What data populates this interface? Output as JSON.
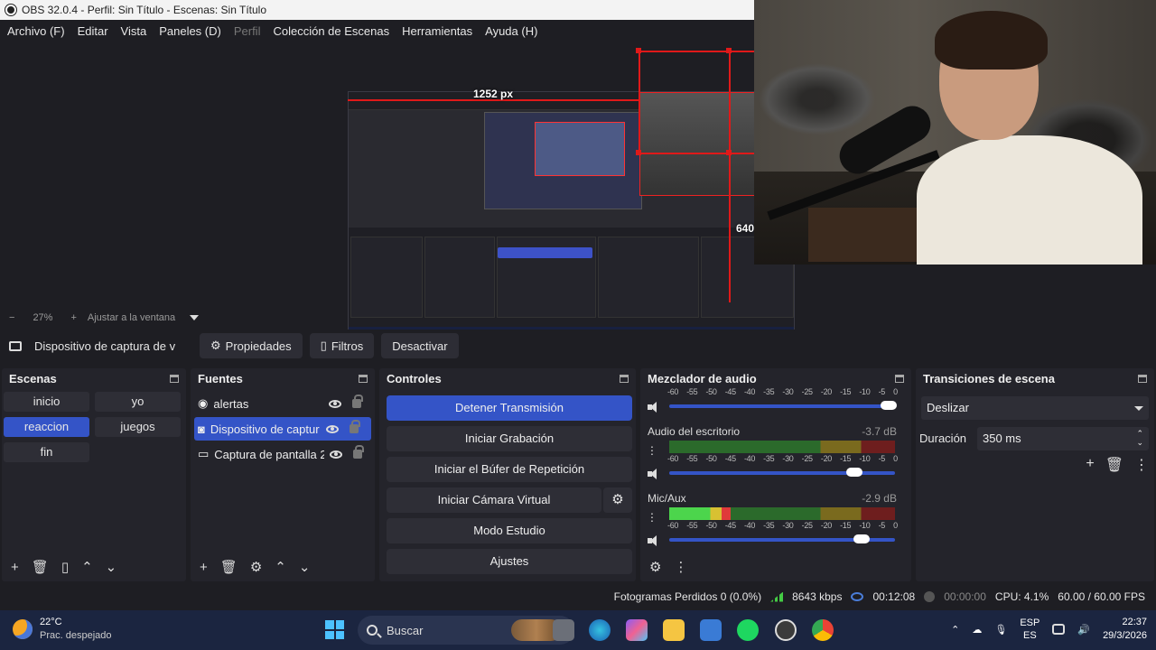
{
  "window": {
    "title": "OBS 32.0.4 - Perfil: Sin Título - Escenas: Sin Título"
  },
  "menu": [
    "Archivo (F)",
    "Editar",
    "Vista",
    "Paneles (D)",
    "Perfil",
    "Colección de Escenas",
    "Herramientas",
    "Ayuda (H)"
  ],
  "preview": {
    "width_label": "1252 px",
    "height_label": "640",
    "zoom": "27%",
    "fit_label": "Ajustar a la ventana"
  },
  "source_toolbar": {
    "source_name": "Dispositivo de captura de v",
    "properties": "Propiedades",
    "filters": "Filtros",
    "deactivate": "Desactivar"
  },
  "scenes": {
    "title": "Escenas",
    "items": [
      "inicio",
      "yo",
      "reaccion",
      "juegos",
      "fin"
    ],
    "active": "reaccion"
  },
  "sources": {
    "title": "Fuentes",
    "items": [
      "alertas",
      "Dispositivo de captur",
      "Captura de pantalla 2"
    ]
  },
  "controls": {
    "title": "Controles",
    "buttons": [
      "Detener Transmisión",
      "Iniciar Grabación",
      "Iniciar el Búfer de Repetición",
      "Iniciar Cámara Virtual",
      "Modo Estudio",
      "Ajustes"
    ]
  },
  "mixer": {
    "title": "Mezclador de audio",
    "scale": [
      "-60",
      "-55",
      "-50",
      "-45",
      "-40",
      "-35",
      "-30",
      "-25",
      "-20",
      "-15",
      "-10",
      "-5",
      "0"
    ],
    "channels": [
      {
        "name": "Audio del escritorio",
        "db": "-3.7 dB",
        "level": 0.0,
        "volume": 0.82
      },
      {
        "name": "Mic/Aux",
        "db": "-2.9 dB",
        "level": 0.27,
        "volume": 0.85
      }
    ],
    "top_volume": 0.97
  },
  "transitions": {
    "title": "Transiciones de escena",
    "selected": "Deslizar",
    "duration_label": "Duración",
    "duration_value": "350 ms"
  },
  "status": {
    "dropped_frames": "Fotogramas Perdidos 0 (0.0%)",
    "bitrate": "8643 kbps",
    "live_time": "00:12:08",
    "rec_time": "00:00:00",
    "cpu": "CPU: 4.1%",
    "fps": "60.00 / 60.00 FPS"
  },
  "taskbar": {
    "temp": "22°C",
    "weather": "Prac. despejado",
    "search": "Buscar",
    "lang1": "ESP",
    "lang2": "ES",
    "time": "22:37",
    "date": "29/3/2026"
  }
}
